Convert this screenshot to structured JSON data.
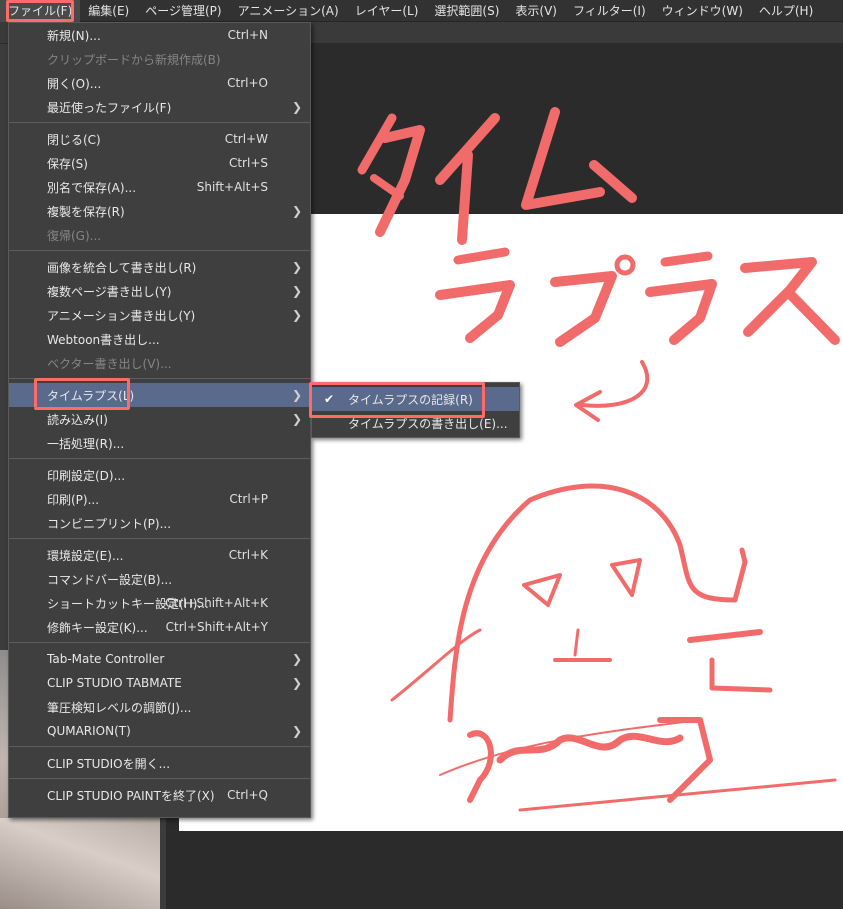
{
  "menubar": {
    "items": [
      {
        "label": "ファイル(F)"
      },
      {
        "label": "編集(E)"
      },
      {
        "label": "ページ管理(P)"
      },
      {
        "label": "アニメーション(A)"
      },
      {
        "label": "レイヤー(L)"
      },
      {
        "label": "選択範囲(S)"
      },
      {
        "label": "表示(V)"
      },
      {
        "label": "フィルター(I)"
      },
      {
        "label": "ウィンドウ(W)"
      },
      {
        "label": "ヘルプ(H)"
      }
    ]
  },
  "file_menu": {
    "items": [
      {
        "label": "新規(N)...",
        "shortcut": "Ctrl+N"
      },
      {
        "label": "クリップボードから新規作成(B)",
        "shortcut": ""
      },
      {
        "label": "開く(O)...",
        "shortcut": "Ctrl+O"
      },
      {
        "label": "最近使ったファイル(F)",
        "shortcut": ""
      },
      {
        "label": "閉じる(C)",
        "shortcut": "Ctrl+W"
      },
      {
        "label": "保存(S)",
        "shortcut": "Ctrl+S"
      },
      {
        "label": "別名で保存(A)...",
        "shortcut": "Shift+Alt+S"
      },
      {
        "label": "複製を保存(R)",
        "shortcut": ""
      },
      {
        "label": "復帰(G)...",
        "shortcut": ""
      },
      {
        "label": "画像を統合して書き出し(R)",
        "shortcut": ""
      },
      {
        "label": "複数ページ書き出し(Y)",
        "shortcut": ""
      },
      {
        "label": "アニメーション書き出し(Y)",
        "shortcut": ""
      },
      {
        "label": "Webtoon書き出し...",
        "shortcut": ""
      },
      {
        "label": "ベクター書き出し(V)...",
        "shortcut": ""
      },
      {
        "label": "タイムラプス(L)",
        "shortcut": ""
      },
      {
        "label": "読み込み(I)",
        "shortcut": ""
      },
      {
        "label": "一括処理(R)...",
        "shortcut": ""
      },
      {
        "label": "印刷設定(D)...",
        "shortcut": ""
      },
      {
        "label": "印刷(P)...",
        "shortcut": "Ctrl+P"
      },
      {
        "label": "コンビニプリント(P)...",
        "shortcut": ""
      },
      {
        "label": "環境設定(E)...",
        "shortcut": "Ctrl+K"
      },
      {
        "label": "コマンドバー設定(B)...",
        "shortcut": ""
      },
      {
        "label": "ショートカットキー設定(H)...",
        "shortcut": "Ctrl+Shift+Alt+K"
      },
      {
        "label": "修飾キー設定(K)...",
        "shortcut": "Ctrl+Shift+Alt+Y"
      },
      {
        "label": "Tab-Mate Controller",
        "shortcut": ""
      },
      {
        "label": "CLIP STUDIO TABMATE",
        "shortcut": ""
      },
      {
        "label": "筆圧検知レベルの調節(J)...",
        "shortcut": ""
      },
      {
        "label": "QUMARION(T)",
        "shortcut": ""
      },
      {
        "label": "CLIP STUDIOを開く...",
        "shortcut": ""
      },
      {
        "label": "CLIP STUDIO PAINTを終了(X)",
        "shortcut": "Ctrl+Q"
      }
    ]
  },
  "timelapse_submenu": {
    "items": [
      {
        "label": "タイムラプスの記録(R)"
      },
      {
        "label": "タイムラプスの書き出し(E)..."
      }
    ]
  },
  "colors": {
    "highlight": "#ff6b6b",
    "menu_bg": "#3f3f3f",
    "selected_bg": "#5a6a8c"
  },
  "annotation": {
    "text_line1": "タイム",
    "text_line2": "ラプラス"
  }
}
